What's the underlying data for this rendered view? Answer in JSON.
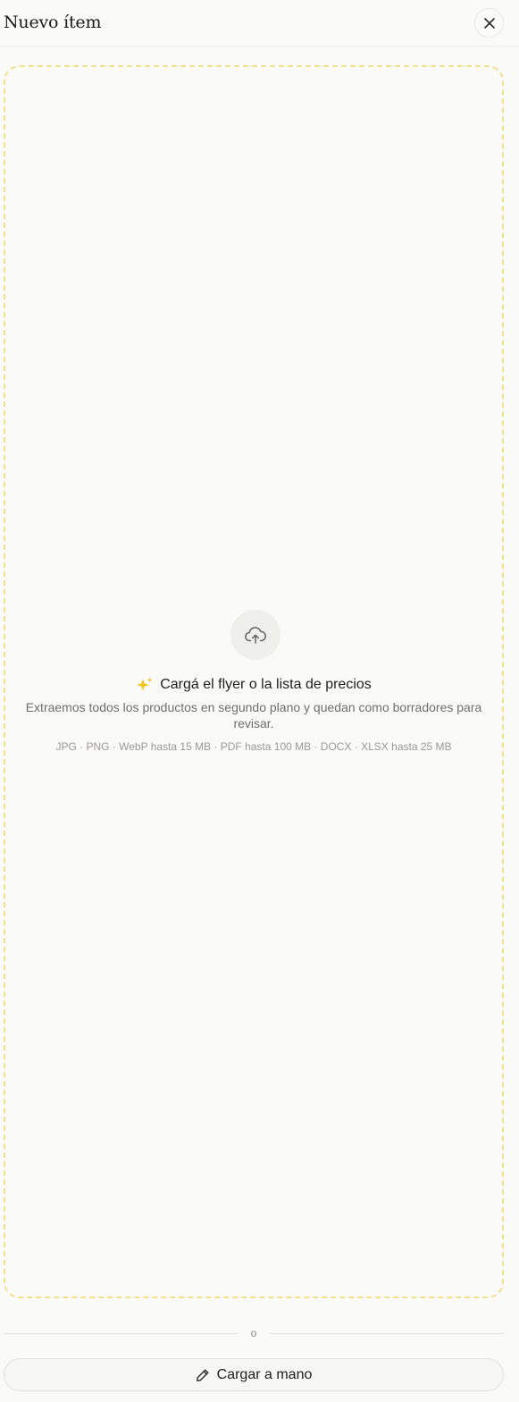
{
  "header": {
    "title": "Nuevo ítem",
    "close_icon": "close-icon"
  },
  "dropzone": {
    "upload_icon": "cloud-upload-icon",
    "sparkle_icon": "sparkles-icon",
    "heading": "Cargá el flyer o la lista de precios",
    "description": "Extraemos todos los productos en segundo plano y quedan como borradores para revisar.",
    "formats": "JPG · PNG · WebP hasta 15 MB · PDF hasta 100 MB · DOCX · XLSX hasta 25 MB",
    "border_color": "#f4df8e",
    "accent_color": "#f0c419"
  },
  "separator": {
    "label": "o"
  },
  "manual": {
    "icon": "pencil-icon",
    "label": "Cargar a mano"
  }
}
